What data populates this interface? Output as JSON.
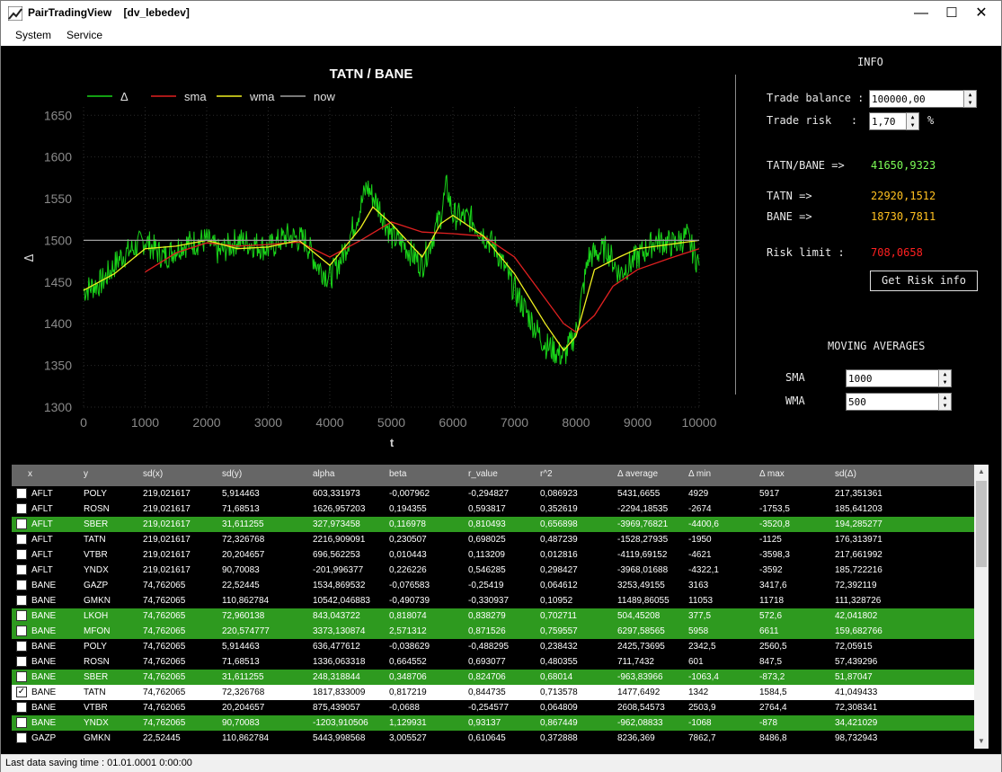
{
  "window": {
    "app_title": "PairTradingView",
    "user_tag": "[dv_lebedev]",
    "minimize": "—",
    "maximize": "☐",
    "close": "✕"
  },
  "menu": [
    "System",
    "Service"
  ],
  "chart_data": {
    "type": "line",
    "title": "TATN / BANE",
    "xlabel": "t",
    "ylabel": "Δ",
    "xlim": [
      0,
      10000
    ],
    "ylim": [
      1300,
      1660
    ],
    "xticks": [
      "0",
      "1000",
      "2000",
      "3000",
      "4000",
      "5000",
      "6000",
      "7000",
      "8000",
      "9000",
      "10000"
    ],
    "yticks": [
      "1300",
      "1350",
      "1400",
      "1450",
      "1500",
      "1550",
      "1600",
      "1650"
    ],
    "grid": true,
    "legend_position": "top-left",
    "series": [
      {
        "name": "Δ",
        "color": "#19d419",
        "x": [
          0,
          300,
          600,
          1000,
          1300,
          1600,
          2000,
          2200,
          2500,
          2800,
          3000,
          3300,
          3600,
          3800,
          4000,
          4200,
          4500,
          4600,
          4800,
          5000,
          5200,
          5500,
          5800,
          5900,
          6000,
          6300,
          6700,
          7000,
          7300,
          7500,
          7800,
          8000,
          8200,
          8500,
          8700,
          9000,
          9300,
          9600,
          9800,
          10000
        ],
        "y": [
          1440,
          1450,
          1480,
          1500,
          1480,
          1495,
          1500,
          1485,
          1500,
          1495,
          1490,
          1505,
          1500,
          1470,
          1455,
          1480,
          1540,
          1565,
          1540,
          1505,
          1495,
          1470,
          1530,
          1565,
          1530,
          1525,
          1490,
          1440,
          1400,
          1375,
          1360,
          1390,
          1480,
          1490,
          1460,
          1480,
          1500,
          1495,
          1505,
          1470
        ]
      },
      {
        "name": "sma",
        "color": "#e02020",
        "x": [
          1000,
          1500,
          2000,
          2500,
          3000,
          3500,
          4000,
          4500,
          5000,
          5500,
          6000,
          6500,
          7000,
          7500,
          7800,
          8000,
          8300,
          8600,
          9000,
          9500,
          10000
        ],
        "y": [
          1462,
          1485,
          1497,
          1493,
          1495,
          1498,
          1480,
          1500,
          1522,
          1510,
          1508,
          1505,
          1480,
          1430,
          1400,
          1390,
          1410,
          1445,
          1465,
          1478,
          1490
        ]
      },
      {
        "name": "wma",
        "color": "#f0f020",
        "x": [
          0,
          500,
          1000,
          1500,
          2000,
          2500,
          3000,
          3500,
          4000,
          4500,
          4700,
          5000,
          5500,
          5800,
          6000,
          6500,
          7000,
          7500,
          7800,
          8000,
          8300,
          8700,
          9000,
          9500,
          10000
        ],
        "y": [
          1440,
          1460,
          1490,
          1493,
          1500,
          1490,
          1492,
          1500,
          1470,
          1515,
          1540,
          1520,
          1480,
          1520,
          1530,
          1505,
          1460,
          1400,
          1368,
          1385,
          1465,
          1480,
          1490,
          1495,
          1500
        ]
      },
      {
        "name": "now",
        "color": "#a0a0a0",
        "x": [
          0,
          10000
        ],
        "y": [
          1500,
          1500
        ]
      }
    ]
  },
  "info": {
    "title": "INFO",
    "trade_balance_label": "Trade balance :",
    "trade_balance_value": "100000,00",
    "trade_risk_label": "Trade risk   :",
    "trade_risk_value": "1,70",
    "trade_risk_unit": "%",
    "pair_label": "TATN/BANE =>",
    "pair_value": "41650,9323",
    "pair_color": "#7dfc56",
    "tatn_label": "TATN =>",
    "tatn_value": "22920,1512",
    "bane_label": "BANE =>",
    "bane_value": "18730,7811",
    "leg_color": "#ffc020",
    "risk_limit_label": "Risk limit :",
    "risk_limit_value": "708,0658",
    "risk_color": "#ff2020",
    "get_risk_button": "Get Risk info",
    "ma_title": "MOVING AVERAGES",
    "sma_label": "SMA",
    "sma_value": "1000",
    "wma_label": "WMA",
    "wma_value": "500"
  },
  "table": {
    "columns": [
      "x",
      "y",
      "sd(x)",
      "sd(y)",
      "alpha",
      "beta",
      "r_value",
      "r^2",
      "Δ average",
      "Δ min",
      "Δ max",
      "sd(Δ)"
    ],
    "rows": [
      {
        "hl": "none",
        "checked": false,
        "cells": [
          "AFLT",
          "POLY",
          "219,021617",
          "5,914463",
          "603,331973",
          "-0,007962",
          "-0,294827",
          "0,086923",
          "5431,6655",
          "4929",
          "5917",
          "217,351361"
        ]
      },
      {
        "hl": "none",
        "checked": false,
        "cells": [
          "AFLT",
          "ROSN",
          "219,021617",
          "71,68513",
          "1626,957203",
          "0,194355",
          "0,593817",
          "0,352619",
          "-2294,18535",
          "-2674",
          "-1753,5",
          "185,641203"
        ]
      },
      {
        "hl": "green",
        "checked": false,
        "cells": [
          "AFLT",
          "SBER",
          "219,021617",
          "31,611255",
          "327,973458",
          "0,116978",
          "0,810493",
          "0,656898",
          "-3969,76821",
          "-4400,6",
          "-3520,8",
          "194,285277"
        ]
      },
      {
        "hl": "none",
        "checked": false,
        "cells": [
          "AFLT",
          "TATN",
          "219,021617",
          "72,326768",
          "2216,909091",
          "0,230507",
          "0,698025",
          "0,487239",
          "-1528,27935",
          "-1950",
          "-1125",
          "176,313971"
        ]
      },
      {
        "hl": "none",
        "checked": false,
        "cells": [
          "AFLT",
          "VTBR",
          "219,021617",
          "20,204657",
          "696,562253",
          "0,010443",
          "0,113209",
          "0,012816",
          "-4119,69152",
          "-4621",
          "-3598,3",
          "217,661992"
        ]
      },
      {
        "hl": "none",
        "checked": false,
        "cells": [
          "AFLT",
          "YNDX",
          "219,021617",
          "90,70083",
          "-201,996377",
          "0,226226",
          "0,546285",
          "0,298427",
          "-3968,01688",
          "-4322,1",
          "-3592",
          "185,722216"
        ]
      },
      {
        "hl": "none",
        "checked": false,
        "cells": [
          "BANE",
          "GAZP",
          "74,762065",
          "22,52445",
          "1534,869532",
          "-0,076583",
          "-0,25419",
          "0,064612",
          "3253,49155",
          "3163",
          "3417,6",
          "72,392119"
        ]
      },
      {
        "hl": "none",
        "checked": false,
        "cells": [
          "BANE",
          "GMKN",
          "74,762065",
          "110,862784",
          "10542,046883",
          "-0,490739",
          "-0,330937",
          "0,10952",
          "11489,86055",
          "11053",
          "11718",
          "111,328726"
        ]
      },
      {
        "hl": "green",
        "checked": false,
        "cells": [
          "BANE",
          "LKOH",
          "74,762065",
          "72,960138",
          "843,043722",
          "0,818074",
          "0,838279",
          "0,702711",
          "504,45208",
          "377,5",
          "572,6",
          "42,041802"
        ]
      },
      {
        "hl": "green",
        "checked": false,
        "cells": [
          "BANE",
          "MFON",
          "74,762065",
          "220,574777",
          "3373,130874",
          "2,571312",
          "0,871526",
          "0,759557",
          "6297,58565",
          "5958",
          "6611",
          "159,682766"
        ]
      },
      {
        "hl": "none",
        "checked": false,
        "cells": [
          "BANE",
          "POLY",
          "74,762065",
          "5,914463",
          "636,477612",
          "-0,038629",
          "-0,488295",
          "0,238432",
          "2425,73695",
          "2342,5",
          "2560,5",
          "72,05915"
        ]
      },
      {
        "hl": "none",
        "checked": false,
        "cells": [
          "BANE",
          "ROSN",
          "74,762065",
          "71,68513",
          "1336,063318",
          "0,664552",
          "0,693077",
          "0,480355",
          "711,7432",
          "601",
          "847,5",
          "57,439296"
        ]
      },
      {
        "hl": "green",
        "checked": false,
        "cells": [
          "BANE",
          "SBER",
          "74,762065",
          "31,611255",
          "248,318844",
          "0,348706",
          "0,824706",
          "0,68014",
          "-963,83966",
          "-1063,4",
          "-873,2",
          "51,87047"
        ]
      },
      {
        "hl": "white",
        "checked": true,
        "cells": [
          "BANE",
          "TATN",
          "74,762065",
          "72,326768",
          "1817,833009",
          "0,817219",
          "0,844735",
          "0,713578",
          "1477,6492",
          "1342",
          "1584,5",
          "41,049433"
        ]
      },
      {
        "hl": "none",
        "checked": false,
        "cells": [
          "BANE",
          "VTBR",
          "74,762065",
          "20,204657",
          "875,439057",
          "-0,0688",
          "-0,254577",
          "0,064809",
          "2608,54573",
          "2503,9",
          "2764,4",
          "72,308341"
        ]
      },
      {
        "hl": "green",
        "checked": false,
        "cells": [
          "BANE",
          "YNDX",
          "74,762065",
          "90,70083",
          "-1203,910506",
          "1,129931",
          "0,93137",
          "0,867449",
          "-962,08833",
          "-1068",
          "-878",
          "34,421029"
        ]
      },
      {
        "hl": "none",
        "checked": false,
        "cells": [
          "GAZP",
          "GMKN",
          "22,52445",
          "110,862784",
          "5443,998568",
          "3,005527",
          "0,610645",
          "0,372888",
          "8236,369",
          "7862,7",
          "8486,8",
          "98,732943"
        ]
      }
    ]
  },
  "status": {
    "text": "Last data saving time : 01.01.0001 0:00:00"
  }
}
